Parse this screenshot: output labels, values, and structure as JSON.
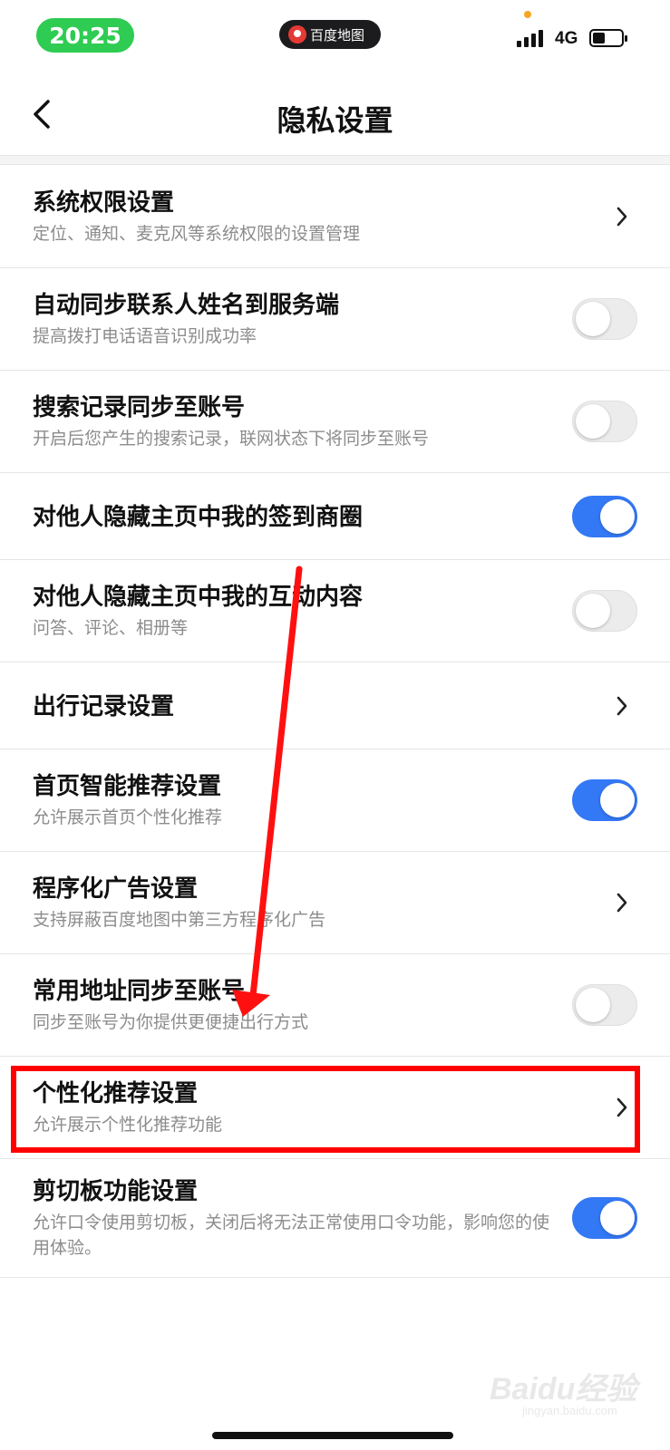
{
  "status_bar": {
    "time": "20:25",
    "app_indicator": "百度地图",
    "network": "4G",
    "battery_level": 0.4
  },
  "header": {
    "title": "隐私设置",
    "back_icon": "chevron-left-icon"
  },
  "settings": [
    {
      "title": "系统权限设置",
      "subtitle": "定位、通知、麦克风等系统权限的设置管理",
      "control": "chevron"
    },
    {
      "title": "自动同步联系人姓名到服务端",
      "subtitle": "提高拨打电话语音识别成功率",
      "control": "toggle",
      "on": false
    },
    {
      "title": "搜索记录同步至账号",
      "subtitle": "开启后您产生的搜索记录，联网状态下将同步至账号",
      "control": "toggle",
      "on": false
    },
    {
      "title": "对他人隐藏主页中我的签到商圈",
      "subtitle": "",
      "control": "toggle",
      "on": true
    },
    {
      "title": "对他人隐藏主页中我的互动内容",
      "subtitle": "问答、评论、相册等",
      "control": "toggle",
      "on": false
    },
    {
      "title": "出行记录设置",
      "subtitle": "",
      "control": "chevron"
    },
    {
      "title": "首页智能推荐设置",
      "subtitle": "允许展示首页个性化推荐",
      "control": "toggle",
      "on": true
    },
    {
      "title": "程序化广告设置",
      "subtitle": "支持屏蔽百度地图中第三方程序化广告",
      "control": "chevron"
    },
    {
      "title": "常用地址同步至账号",
      "subtitle": "同步至账号为你提供更便捷出行方式",
      "control": "toggle",
      "on": false
    },
    {
      "title": "个性化推荐设置",
      "subtitle": "允许展示个性化推荐功能",
      "control": "chevron"
    },
    {
      "title": "剪切板功能设置",
      "subtitle": "允许口令使用剪切板，关闭后将无法正常使用口令功能，影响您的使用体验。",
      "control": "toggle",
      "on": true
    }
  ],
  "colors": {
    "toggle_on": "#3378f5",
    "toggle_off": "#ececec",
    "annotation": "#ff0000",
    "time_pill": "#2ecc52"
  },
  "watermark": {
    "brand": "Baidu经验",
    "url": "jingyan.baidu.com"
  }
}
